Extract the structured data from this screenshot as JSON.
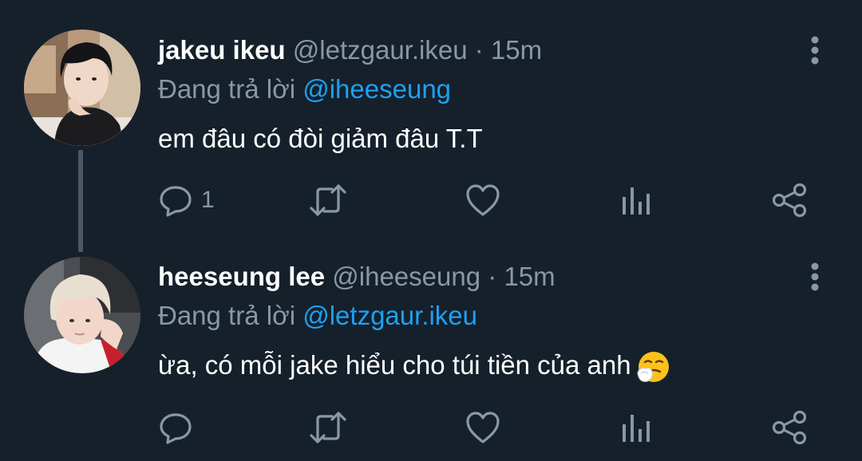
{
  "tweets": [
    {
      "display_name": "jakeu ikeu",
      "handle": "@letzgaur.ikeu",
      "separator": "·",
      "time": "15m",
      "reply_prefix": "Đang trả lời",
      "reply_to": "@iheeseung",
      "text": "em đâu có đòi giảm đâu T.T",
      "reply_count": "1",
      "icons": [
        "comment-icon",
        "retweet-icon",
        "heart-icon",
        "analytics-icon",
        "share-icon",
        "more-vertical-icon"
      ]
    },
    {
      "display_name": "heeseung lee",
      "handle": "@iheeseung",
      "separator": "·",
      "time": "15m",
      "reply_prefix": "Đang trả lời",
      "reply_to": "@letzgaur.ikeu",
      "text": "ừa, có mỗi jake hiểu cho túi tiền của anh",
      "emoji": "sneezing-face-emoji",
      "reply_count": "",
      "icons": [
        "comment-icon",
        "retweet-icon",
        "heart-icon",
        "analytics-icon",
        "share-icon",
        "more-vertical-icon"
      ]
    }
  ],
  "colors": {
    "background": "#15202b",
    "text": "#ffffff",
    "muted": "#8899a6",
    "link": "#1da1f2",
    "thread_line": "#4a5866"
  }
}
